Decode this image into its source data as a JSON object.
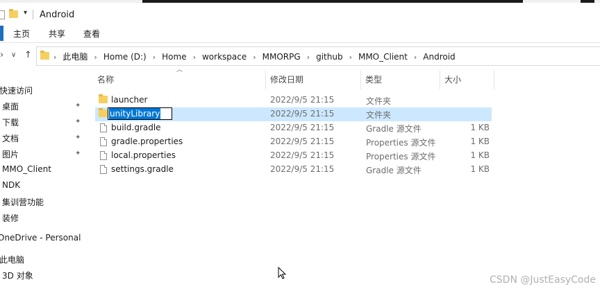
{
  "window": {
    "title": "Android"
  },
  "ribbon": {
    "tabs": [
      "主页",
      "共享",
      "查看"
    ]
  },
  "address": {
    "crumbs": [
      "此电脑",
      "Home (D:)",
      "Home",
      "workspace",
      "MMORPG",
      "github",
      "MMO_Client",
      "Android"
    ]
  },
  "sidebar": {
    "items": [
      {
        "label": "快速访问",
        "pinned": false
      },
      {
        "label": "桌面",
        "pinned": true
      },
      {
        "label": "下载",
        "pinned": true
      },
      {
        "label": "文档",
        "pinned": true
      },
      {
        "label": "图片",
        "pinned": true
      },
      {
        "label": "MMO_Client",
        "pinned": false
      },
      {
        "label": "NDK",
        "pinned": false
      },
      {
        "label": "集训营功能",
        "pinned": false
      },
      {
        "label": "装修",
        "pinned": false
      },
      {
        "label": "OneDrive - Personal",
        "pinned": false
      },
      {
        "label": "此电脑",
        "pinned": false
      },
      {
        "label": "3D 对象",
        "pinned": false
      }
    ]
  },
  "columns": {
    "name": "名称",
    "date": "修改日期",
    "type": "类型",
    "size": "大小"
  },
  "files": [
    {
      "name": "launcher",
      "date": "2022/9/5 21:15",
      "type": "文件夹",
      "size": "",
      "kind": "folder"
    },
    {
      "name": "unityLibrary",
      "date": "2022/9/5 21:15",
      "type": "文件夹",
      "size": "",
      "kind": "folder",
      "selected": true,
      "renaming": true
    },
    {
      "name": "build.gradle",
      "date": "2022/9/5 21:15",
      "type": "Gradle 源文件",
      "size": "1 KB",
      "kind": "file"
    },
    {
      "name": "gradle.properties",
      "date": "2022/9/5 21:15",
      "type": "Properties 源文件",
      "size": "1 KB",
      "kind": "file"
    },
    {
      "name": "local.properties",
      "date": "2022/9/5 21:15",
      "type": "Properties 源文件",
      "size": "1 KB",
      "kind": "file"
    },
    {
      "name": "settings.gradle",
      "date": "2022/9/5 21:15",
      "type": "Gradle 源文件",
      "size": "1 KB",
      "kind": "file"
    }
  ],
  "watermark": "CSDN @JustEasyCode",
  "colors": {
    "selection": "#cce8ff",
    "folder": "#f6cf60",
    "accent": "#0078d7"
  }
}
